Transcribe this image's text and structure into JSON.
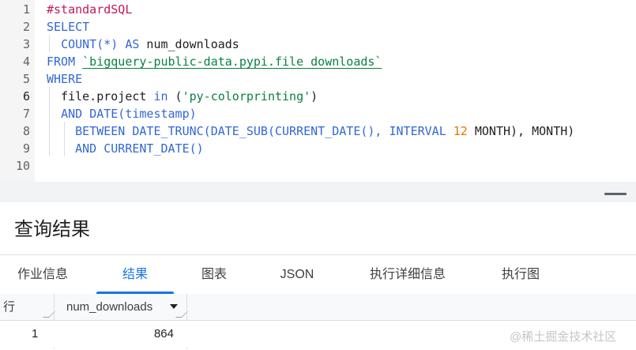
{
  "editor": {
    "lines": [
      {
        "num": "1",
        "tokens": [
          {
            "t": "#standardSQL",
            "c": "cm"
          }
        ]
      },
      {
        "num": "2",
        "tokens": [
          {
            "t": "SELECT",
            "c": "kw"
          }
        ]
      },
      {
        "num": "3",
        "tokens": [
          {
            "t": "  ",
            "c": "id"
          },
          {
            "t": "COUNT(*)",
            "c": "kw"
          },
          {
            "t": " ",
            "c": "id"
          },
          {
            "t": "AS",
            "c": "kw"
          },
          {
            "t": " num_downloads",
            "c": "id"
          }
        ]
      },
      {
        "num": "4",
        "tokens": [
          {
            "t": "FROM",
            "c": "kw"
          },
          {
            "t": " ",
            "c": "id"
          },
          {
            "t": "`bigquery-public-data.pypi.file_downloads`",
            "c": "str underline"
          }
        ]
      },
      {
        "num": "5",
        "tokens": [
          {
            "t": "WHERE",
            "c": "kw"
          }
        ]
      },
      {
        "num": "6",
        "tokens": [
          {
            "t": "  file.project ",
            "c": "id"
          },
          {
            "t": "in",
            "c": "kw"
          },
          {
            "t": " (",
            "c": "id"
          },
          {
            "t": "'py-colorprinting'",
            "c": "str"
          },
          {
            "t": ")",
            "c": "id"
          }
        ]
      },
      {
        "num": "7",
        "tokens": [
          {
            "t": "  ",
            "c": "id"
          },
          {
            "t": "AND",
            "c": "kw"
          },
          {
            "t": " ",
            "c": "id"
          },
          {
            "t": "DATE(timestamp)",
            "c": "kw"
          }
        ]
      },
      {
        "num": "8",
        "tokens": [
          {
            "t": "    ",
            "c": "id"
          },
          {
            "t": "BETWEEN",
            "c": "kw"
          },
          {
            "t": " ",
            "c": "id"
          },
          {
            "t": "DATE_TRUNC(DATE_SUB(CURRENT_DATE(),",
            "c": "kw"
          },
          {
            "t": " ",
            "c": "id"
          },
          {
            "t": "INTERVAL",
            "c": "kw"
          },
          {
            "t": " ",
            "c": "id"
          },
          {
            "t": "12",
            "c": "num"
          },
          {
            "t": " MONTH), MONTH)",
            "c": "id"
          }
        ]
      },
      {
        "num": "9",
        "tokens": [
          {
            "t": "    ",
            "c": "id"
          },
          {
            "t": "AND",
            "c": "kw"
          },
          {
            "t": " ",
            "c": "id"
          },
          {
            "t": "CURRENT_DATE()",
            "c": "kw"
          }
        ]
      },
      {
        "num": "10",
        "tokens": []
      }
    ],
    "active_line": "6"
  },
  "results": {
    "title": "查询结果",
    "tabs": [
      {
        "label": "作业信息",
        "active": false
      },
      {
        "label": "结果",
        "active": true
      },
      {
        "label": "图表",
        "active": false
      },
      {
        "label": "JSON",
        "active": false
      },
      {
        "label": "执行详细信息",
        "active": false
      },
      {
        "label": "执行图",
        "active": false
      }
    ],
    "grid": {
      "row_header": "行",
      "columns": [
        "num_downloads"
      ],
      "rows": [
        {
          "row": "1",
          "values": [
            "864"
          ]
        }
      ]
    }
  },
  "watermark": "@稀土掘金技术社区",
  "colors": {
    "keyword": "#3367d6",
    "comment": "#c2185b",
    "string": "#0b8043",
    "number": "#e37400",
    "accent": "#1a73e8"
  }
}
